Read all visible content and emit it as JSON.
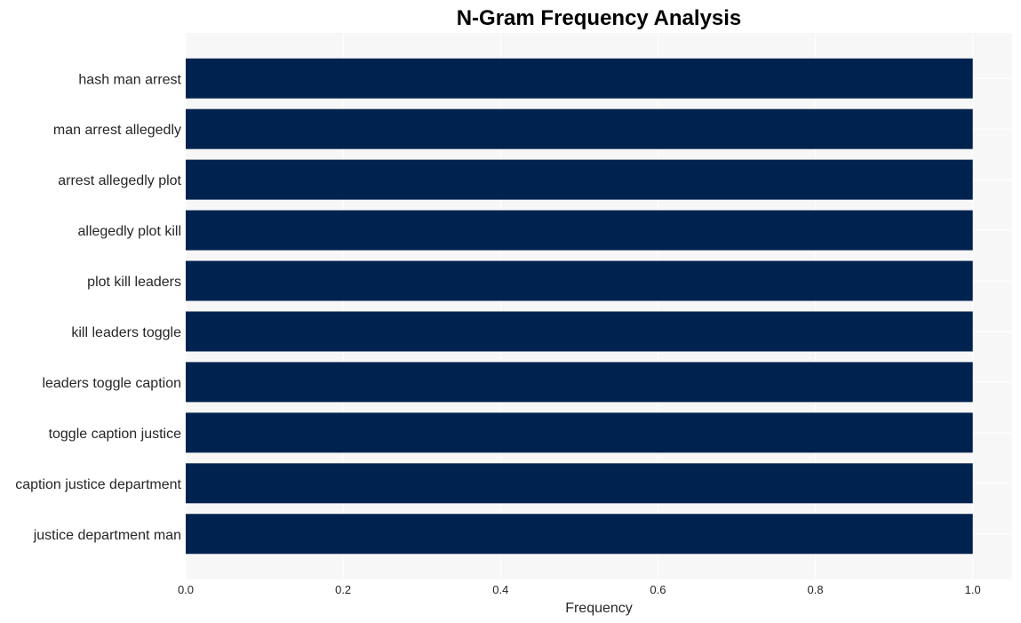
{
  "chart_data": {
    "type": "bar",
    "orientation": "horizontal",
    "title": "N-Gram Frequency Analysis",
    "xlabel": "Frequency",
    "ylabel": "",
    "categories": [
      "hash man arrest",
      "man arrest allegedly",
      "arrest allegedly plot",
      "allegedly plot kill",
      "plot kill leaders",
      "kill leaders toggle",
      "leaders toggle caption",
      "toggle caption justice",
      "caption justice department",
      "justice department man"
    ],
    "values": [
      1,
      1,
      1,
      1,
      1,
      1,
      1,
      1,
      1,
      1
    ],
    "xlim": [
      0,
      1.05
    ],
    "xticks": [
      0.0,
      0.2,
      0.4,
      0.6,
      0.8,
      1.0
    ],
    "xtick_labels": [
      "0.0",
      "0.2",
      "0.4",
      "0.6",
      "0.8",
      "1.0"
    ],
    "grid": true,
    "legend": "none",
    "colors": {
      "bar": "#00224e",
      "plot_background": "#f7f7f7",
      "grid": "#ffffff"
    }
  }
}
